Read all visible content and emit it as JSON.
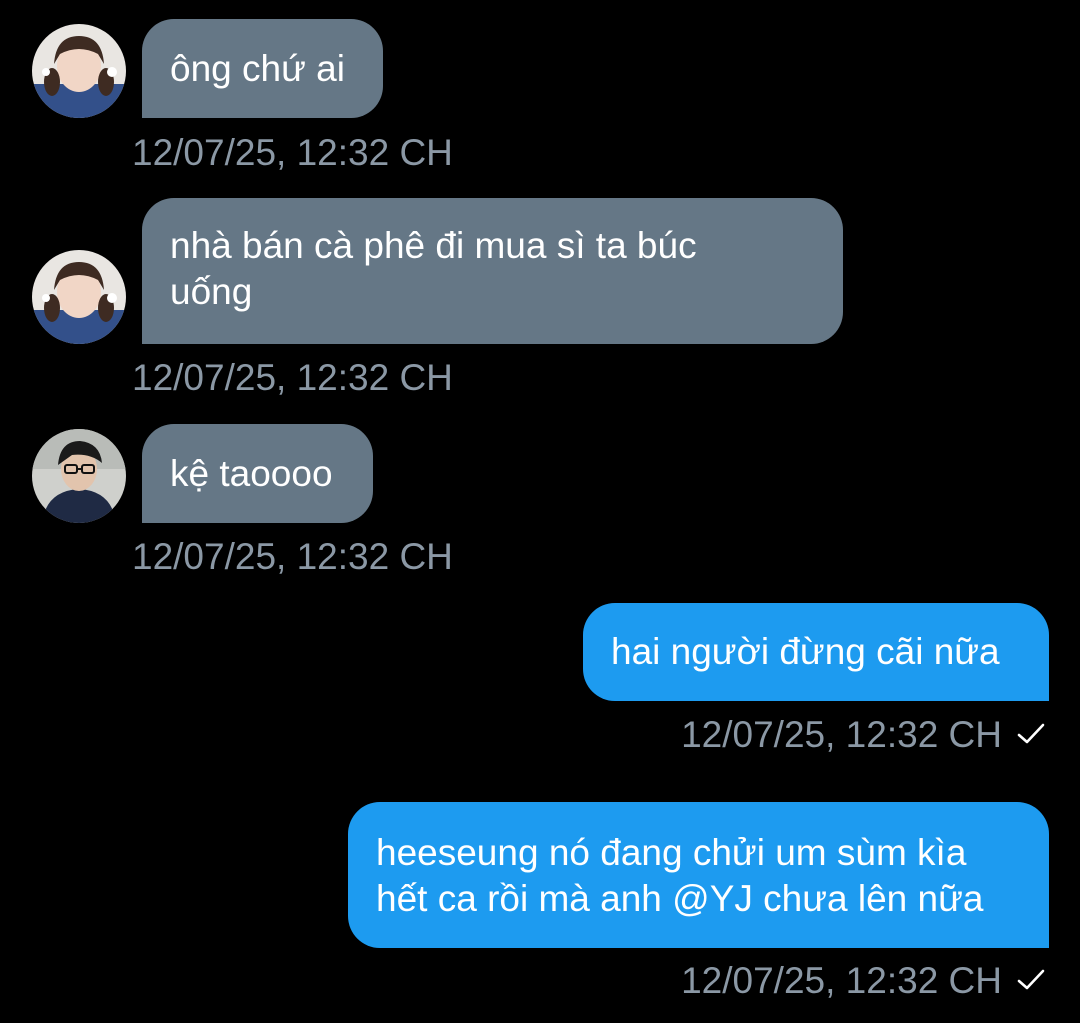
{
  "messages": [
    {
      "direction": "in",
      "avatar": "avatar-girl-pigtails",
      "lines": [
        "ông chứ ai"
      ],
      "time": "12/07/25, 12:32 CH"
    },
    {
      "direction": "in",
      "avatar": "avatar-girl-pigtails",
      "lines": [
        "nhà bán cà phê đi mua sì ta búc",
        "uống"
      ],
      "time": "12/07/25, 12:32 CH"
    },
    {
      "direction": "in",
      "avatar": "avatar-boy-glasses",
      "lines": [
        "kệ taoooo"
      ],
      "time": "12/07/25, 12:32 CH"
    },
    {
      "direction": "out",
      "lines": [
        "hai người đừng cãi nữa"
      ],
      "time": "12/07/25, 12:32 CH",
      "status_icon": "check-icon"
    },
    {
      "direction": "out",
      "lines": [
        "heeseung nó đang chửi um sùm kìa",
        "hết ca rồi mà anh @YJ chưa lên nữa"
      ],
      "time": "12/07/25, 12:32 CH",
      "status_icon": "check-icon"
    }
  ],
  "colors": {
    "background": "#000000",
    "incoming_bubble": "#657786",
    "outgoing_bubble": "#1d9bf0",
    "timestamp": "#8b98a5",
    "text": "#ffffff"
  }
}
